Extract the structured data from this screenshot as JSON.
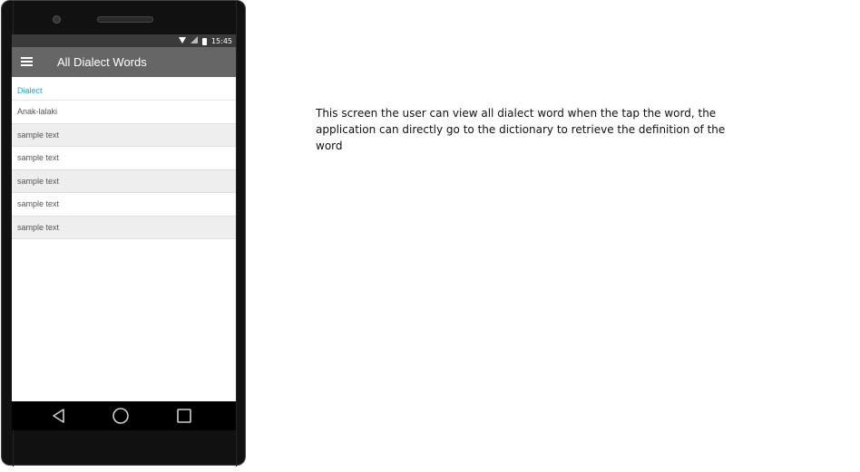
{
  "status_bar": {
    "time": "15:45",
    "icons": [
      "wifi-icon",
      "signal-icon",
      "battery-icon"
    ]
  },
  "app_bar": {
    "title": "All Dialect Words",
    "menu_icon": "hamburger-menu-icon"
  },
  "list": {
    "header": "Dialect",
    "items": [
      {
        "label": "Anak-lalaki"
      },
      {
        "label": "sample text"
      },
      {
        "label": "sample text"
      },
      {
        "label": "sample text"
      },
      {
        "label": "sample text"
      },
      {
        "label": "sample text"
      }
    ]
  },
  "nav_bar": {
    "buttons": [
      "back-icon",
      "home-icon",
      "recent-apps-icon"
    ]
  },
  "description": {
    "text": "This screen the user can view all dialect word when the tap the word, the application can directly go to the dictionary to retrieve the definition of the word"
  },
  "colors": {
    "app_bar": "#666666",
    "accent_header": "#3aa3b0",
    "phone_body": "#111111",
    "alt_row": "#eeeeee"
  }
}
